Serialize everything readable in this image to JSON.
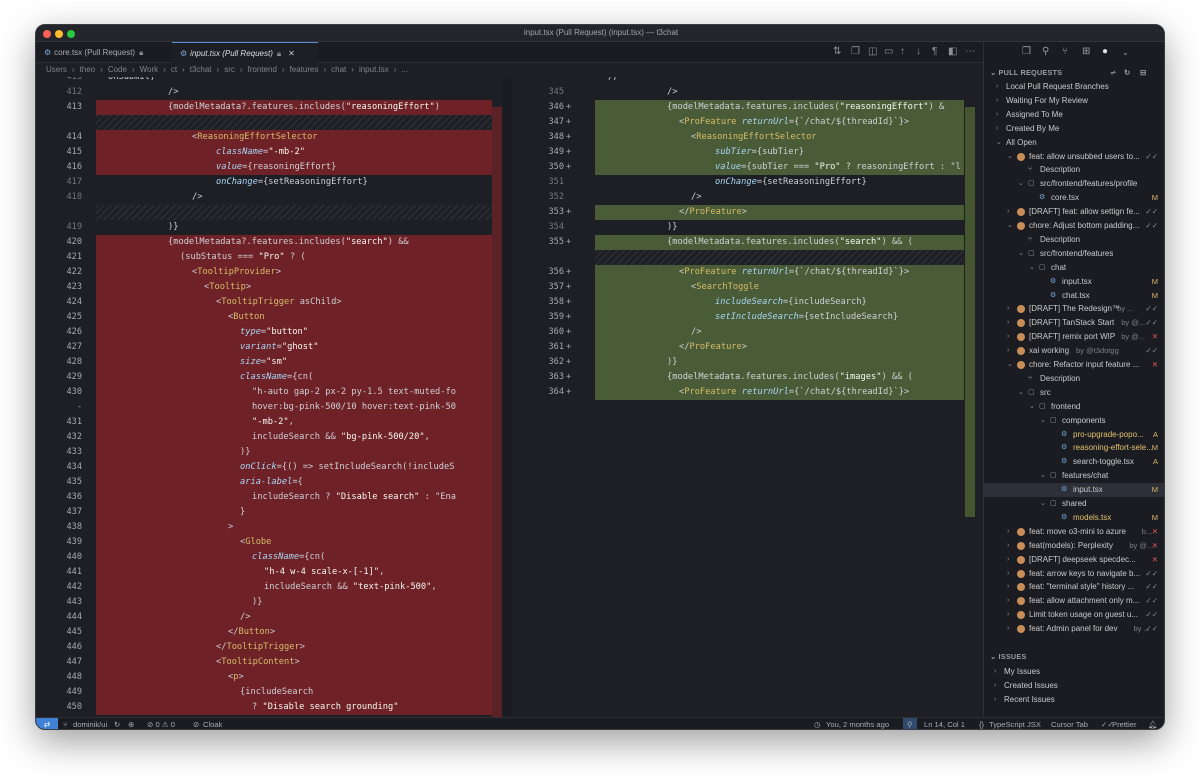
{
  "window": {
    "title": "input.tsx (Pull Request) (input.tsx) — t3chat"
  },
  "tabs": [
    {
      "label": "core.tsx (Pull Request)",
      "active": false
    },
    {
      "label": "input.tsx (Pull Request)",
      "active": true
    }
  ],
  "breadcrumb": [
    "Users",
    "theo",
    "Code",
    "Work",
    "ct",
    "t3chat",
    "src",
    "frontend",
    "features",
    "chat",
    "input.tsx",
    "..."
  ],
  "left_lines": [
    {
      "n": "413",
      "t": "onSubmit,",
      "k": "partial"
    },
    {
      "n": "412",
      "t": "/>",
      "k": "ctx",
      "i": 6
    },
    {
      "n": "413",
      "t": "{modelMetadata?.features.includes(\"reasoningEffort\")",
      "k": "del",
      "i": 6
    },
    {
      "n": "",
      "t": "",
      "k": "hatch"
    },
    {
      "n": "414",
      "t": "<ReasoningEffortSelector",
      "k": "del",
      "i": 8
    },
    {
      "n": "415",
      "t": "className=\"-mb-2\"",
      "k": "del",
      "i": 10
    },
    {
      "n": "416",
      "t": "value={reasoningEffort}",
      "k": "del",
      "i": 10
    },
    {
      "n": "417",
      "t": "onChange={setReasoningEffort}",
      "k": "ctx",
      "i": 10
    },
    {
      "n": "418",
      "t": "/>",
      "k": "ctx",
      "i": 8
    },
    {
      "n": "",
      "t": "",
      "k": "hatch"
    },
    {
      "n": "419",
      "t": ")}",
      "k": "ctx",
      "i": 6
    },
    {
      "n": "420",
      "t": "{modelMetadata?.features.includes(\"search\") &&",
      "k": "del",
      "i": 6
    },
    {
      "n": "421",
      "t": "(subStatus === \"Pro\" ? (",
      "k": "del",
      "i": 7
    },
    {
      "n": "422",
      "t": "<TooltipProvider>",
      "k": "del",
      "i": 8
    },
    {
      "n": "423",
      "t": "<Tooltip>",
      "k": "del",
      "i": 9
    },
    {
      "n": "424",
      "t": "<TooltipTrigger asChild>",
      "k": "del",
      "i": 10
    },
    {
      "n": "425",
      "t": "<Button",
      "k": "del",
      "i": 11
    },
    {
      "n": "426",
      "t": "type=\"button\"",
      "k": "del",
      "i": 12
    },
    {
      "n": "427",
      "t": "variant=\"ghost\"",
      "k": "del",
      "i": 12
    },
    {
      "n": "428",
      "t": "size=\"sm\"",
      "k": "del",
      "i": 12
    },
    {
      "n": "429",
      "t": "className={cn(",
      "k": "del",
      "i": 12
    },
    {
      "n": "430",
      "t": "\"h-auto gap-2 px-2 py-1.5 text-muted-fo",
      "k": "del",
      "i": 13
    },
    {
      "n": "-",
      "t": "hover:bg-pink-500/10 hover:text-pink-50",
      "k": "del",
      "i": 13
    },
    {
      "n": "431",
      "t": "\"-mb-2\",",
      "k": "del",
      "i": 13
    },
    {
      "n": "432",
      "t": "includeSearch && \"bg-pink-500/20\",",
      "k": "del",
      "i": 13
    },
    {
      "n": "433",
      "t": ")}",
      "k": "del",
      "i": 12
    },
    {
      "n": "434",
      "t": "onClick={() => setIncludeSearch(!includeS",
      "k": "del",
      "i": 12
    },
    {
      "n": "435",
      "t": "aria-label={",
      "k": "del",
      "i": 12
    },
    {
      "n": "436",
      "t": "includeSearch ? \"Disable search\" : \"Ena",
      "k": "del",
      "i": 13
    },
    {
      "n": "437",
      "t": "}",
      "k": "del",
      "i": 12
    },
    {
      "n": "438",
      "t": ">",
      "k": "del",
      "i": 11
    },
    {
      "n": "439",
      "t": "<Globe",
      "k": "del",
      "i": 12
    },
    {
      "n": "440",
      "t": "className={cn(",
      "k": "del",
      "i": 13
    },
    {
      "n": "441",
      "t": "\"h-4 w-4 scale-x-[-1]\",",
      "k": "del",
      "i": 14
    },
    {
      "n": "442",
      "t": "includeSearch && \"text-pink-500\",",
      "k": "del",
      "i": 14
    },
    {
      "n": "443",
      "t": ")}",
      "k": "del",
      "i": 13
    },
    {
      "n": "444",
      "t": "/>",
      "k": "del",
      "i": 12
    },
    {
      "n": "445",
      "t": "</Button>",
      "k": "del",
      "i": 11
    },
    {
      "n": "446",
      "t": "</TooltipTrigger>",
      "k": "del",
      "i": 10
    },
    {
      "n": "447",
      "t": "<TooltipContent>",
      "k": "del",
      "i": 10
    },
    {
      "n": "448",
      "t": "<p>",
      "k": "del",
      "i": 11
    },
    {
      "n": "449",
      "t": "{includeSearch",
      "k": "del",
      "i": 12
    },
    {
      "n": "450",
      "t": "? \"Disable search grounding\"",
      "k": "del",
      "i": 13
    }
  ],
  "right_lines": [
    {
      "n": "",
      "t": "),",
      "k": "partial",
      "m": ""
    },
    {
      "n": "345",
      "t": "/>",
      "k": "ctx",
      "i": 6,
      "m": ""
    },
    {
      "n": "346",
      "t": "{modelMetadata.features.includes(\"reasoningEffort\") &",
      "k": "add",
      "i": 6,
      "m": "+"
    },
    {
      "n": "347",
      "t": "<ProFeature returnUrl={`/chat/${threadId}`}>",
      "k": "add",
      "i": 7,
      "m": "+"
    },
    {
      "n": "348",
      "t": "<ReasoningEffortSelector",
      "k": "add",
      "i": 8,
      "m": "+"
    },
    {
      "n": "349",
      "t": "subTier={subTier}",
      "k": "add",
      "i": 10,
      "m": "+"
    },
    {
      "n": "350",
      "t": "value={subTier === \"Pro\" ? reasoningEffort : \"l",
      "k": "add",
      "i": 10,
      "m": "+"
    },
    {
      "n": "351",
      "t": "onChange={setReasoningEffort}",
      "k": "ctx",
      "i": 10,
      "m": ""
    },
    {
      "n": "352",
      "t": "/>",
      "k": "ctx",
      "i": 8,
      "m": ""
    },
    {
      "n": "353",
      "t": "</ProFeature>",
      "k": "add",
      "i": 7,
      "m": "+"
    },
    {
      "n": "354",
      "t": ")}",
      "k": "ctx",
      "i": 6,
      "m": ""
    },
    {
      "n": "355",
      "t": "{modelMetadata.features.includes(\"search\") && (",
      "k": "add",
      "i": 6,
      "m": "+"
    },
    {
      "n": "",
      "t": "",
      "k": "hatch",
      "m": ""
    },
    {
      "n": "356",
      "t": "<ProFeature returnUrl={`/chat/${threadId}`}>",
      "k": "add",
      "i": 7,
      "m": "+"
    },
    {
      "n": "357",
      "t": "<SearchToggle",
      "k": "add",
      "i": 8,
      "m": "+"
    },
    {
      "n": "358",
      "t": "includeSearch={includeSearch}",
      "k": "add",
      "i": 10,
      "m": "+"
    },
    {
      "n": "359",
      "t": "setIncludeSearch={setIncludeSearch}",
      "k": "add",
      "i": 10,
      "m": "+"
    },
    {
      "n": "360",
      "t": "/>",
      "k": "add",
      "i": 8,
      "m": "+"
    },
    {
      "n": "361",
      "t": "</ProFeature>",
      "k": "add",
      "i": 7,
      "m": "+"
    },
    {
      "n": "362",
      "t": ")}",
      "k": "add",
      "i": 6,
      "m": "+"
    },
    {
      "n": "363",
      "t": "{modelMetadata.features.includes(\"images\") && (",
      "k": "add",
      "i": 6,
      "m": "+"
    },
    {
      "n": "364",
      "t": "<ProFeature returnUrl={`/chat/${threadId}`}>",
      "k": "add",
      "i": 7,
      "m": "+"
    }
  ],
  "sidebar": {
    "pull_requests_header": "PULL REQUESTS",
    "issues_header": "ISSUES",
    "items": [
      {
        "label": "Local Pull Request Branches",
        "d": 0,
        "c": ">",
        "b": ""
      },
      {
        "label": "Waiting For My Review",
        "d": 0,
        "c": ">",
        "b": ""
      },
      {
        "label": "Assigned To Me",
        "d": 0,
        "c": ">",
        "b": ""
      },
      {
        "label": "Created By Me",
        "d": 0,
        "c": ">",
        "b": ""
      },
      {
        "label": "All Open",
        "d": 0,
        "c": "v",
        "b": ""
      },
      {
        "label": "feat: allow unsubbed users to...",
        "d": 1,
        "c": "v",
        "b": "✓✓",
        "a": true
      },
      {
        "label": "Description",
        "d": 2,
        "c": "",
        "b": "",
        "ic": "desc"
      },
      {
        "label": "src/frontend/features/profile",
        "d": 2,
        "c": "v",
        "b": "",
        "ic": "folder"
      },
      {
        "label": "core.tsx",
        "d": 3,
        "c": "",
        "b": "M",
        "ic": "file"
      },
      {
        "label": "[DRAFT] feat: allow settign fe...",
        "d": 1,
        "c": ">",
        "b": "✓✓",
        "a": true
      },
      {
        "label": "chore: Adjust bottom padding...",
        "d": 1,
        "c": "v",
        "b": "✓✓",
        "a": true
      },
      {
        "label": "Description",
        "d": 2,
        "c": "",
        "b": "",
        "ic": "desc"
      },
      {
        "label": "src/frontend/features",
        "d": 2,
        "c": "v",
        "b": "",
        "ic": "folder"
      },
      {
        "label": "chat",
        "d": 3,
        "c": "v",
        "b": "",
        "ic": "folder"
      },
      {
        "label": "input.tsx",
        "d": 4,
        "c": "",
        "b": "M",
        "ic": "file"
      },
      {
        "label": "chat.tsx",
        "d": 4,
        "c": "",
        "b": "M",
        "ic": "file"
      },
      {
        "label": "[DRAFT] The Redesign™",
        "sub": "by ...",
        "d": 1,
        "c": ">",
        "b": "✓✓",
        "a": true
      },
      {
        "label": "[DRAFT] TanStack Start",
        "sub": "by @...",
        "d": 1,
        "c": ">",
        "b": "✓✓",
        "a": true
      },
      {
        "label": "[DRAFT] remix port WIP",
        "sub": "by @...",
        "d": 1,
        "c": ">",
        "b": "✕",
        "a": true
      },
      {
        "label": "xai working",
        "sub": "by @t3dotgg",
        "d": 1,
        "c": ">",
        "b": "✓✓",
        "a": true
      },
      {
        "label": "chore: Refactor input feature ...",
        "d": 1,
        "c": "v",
        "b": "✕",
        "a": true
      },
      {
        "label": "Description",
        "d": 2,
        "c": "",
        "b": "",
        "ic": "desc"
      },
      {
        "label": "src",
        "d": 2,
        "c": "v",
        "b": "",
        "ic": "folder"
      },
      {
        "label": "frontend",
        "d": 3,
        "c": "v",
        "b": "",
        "ic": "folder"
      },
      {
        "label": "components",
        "d": 4,
        "c": "v",
        "b": "",
        "ic": "folder"
      },
      {
        "label": "pro-upgrade-popo...",
        "d": 5,
        "c": "",
        "b": "A",
        "ic": "file",
        "y": true
      },
      {
        "label": "reasoning-effort-sele...",
        "d": 5,
        "c": "",
        "b": "M",
        "ic": "file",
        "y": true
      },
      {
        "label": "search-toggle.tsx",
        "d": 5,
        "c": "",
        "b": "A",
        "ic": "file"
      },
      {
        "label": "features/chat",
        "d": 4,
        "c": "v",
        "b": "",
        "ic": "folder"
      },
      {
        "label": "input.tsx",
        "d": 5,
        "c": "",
        "b": "M",
        "ic": "file",
        "sel": true
      },
      {
        "label": "shared",
        "d": 4,
        "c": "v",
        "b": "",
        "ic": "folder"
      },
      {
        "label": "models.tsx",
        "d": 5,
        "c": "",
        "b": "M",
        "ic": "file",
        "y": true
      },
      {
        "label": "feat: move o3-mini to azure",
        "sub": "b...",
        "d": 1,
        "c": ">",
        "b": "✕",
        "a": true
      },
      {
        "label": "feat(models): Perplexity",
        "sub": "by @...",
        "d": 1,
        "c": ">",
        "b": "✕",
        "a": true
      },
      {
        "label": "[DRAFT] deepseek specdec...",
        "d": 1,
        "c": ">",
        "b": "✕",
        "a": true
      },
      {
        "label": "feat: arrow keys to navigate b...",
        "d": 1,
        "c": ">",
        "b": "✓✓",
        "a": true
      },
      {
        "label": "feat: \"terminal style\" history ...",
        "d": 1,
        "c": ">",
        "b": "✓✓",
        "a": true
      },
      {
        "label": "feat: allow attachment only m...",
        "d": 1,
        "c": ">",
        "b": "✓✓",
        "a": true
      },
      {
        "label": "Limit token usage on guest u...",
        "d": 1,
        "c": ">",
        "b": "✓✓",
        "a": true
      },
      {
        "label": "feat: Admin panel for dev",
        "sub": "by ...",
        "d": 1,
        "c": ">",
        "b": "✓✓",
        "a": true
      }
    ],
    "issues": [
      "My Issues",
      "Created Issues",
      "Recent Issues"
    ]
  },
  "statusbar": {
    "branch": "dominik/ui",
    "problems": "⊘ 0 ⚠ 0",
    "cloak": "Cloak",
    "blame": "You, 2 months ago",
    "position": "Ln 14, Col 1",
    "language": "TypeScript JSX",
    "cursor_tab": "Cursor Tab",
    "prettier": "Prettier"
  },
  "colors": {
    "deleted": "#6e2228",
    "added": "#4a5c37",
    "accent": "#3f82d6"
  }
}
